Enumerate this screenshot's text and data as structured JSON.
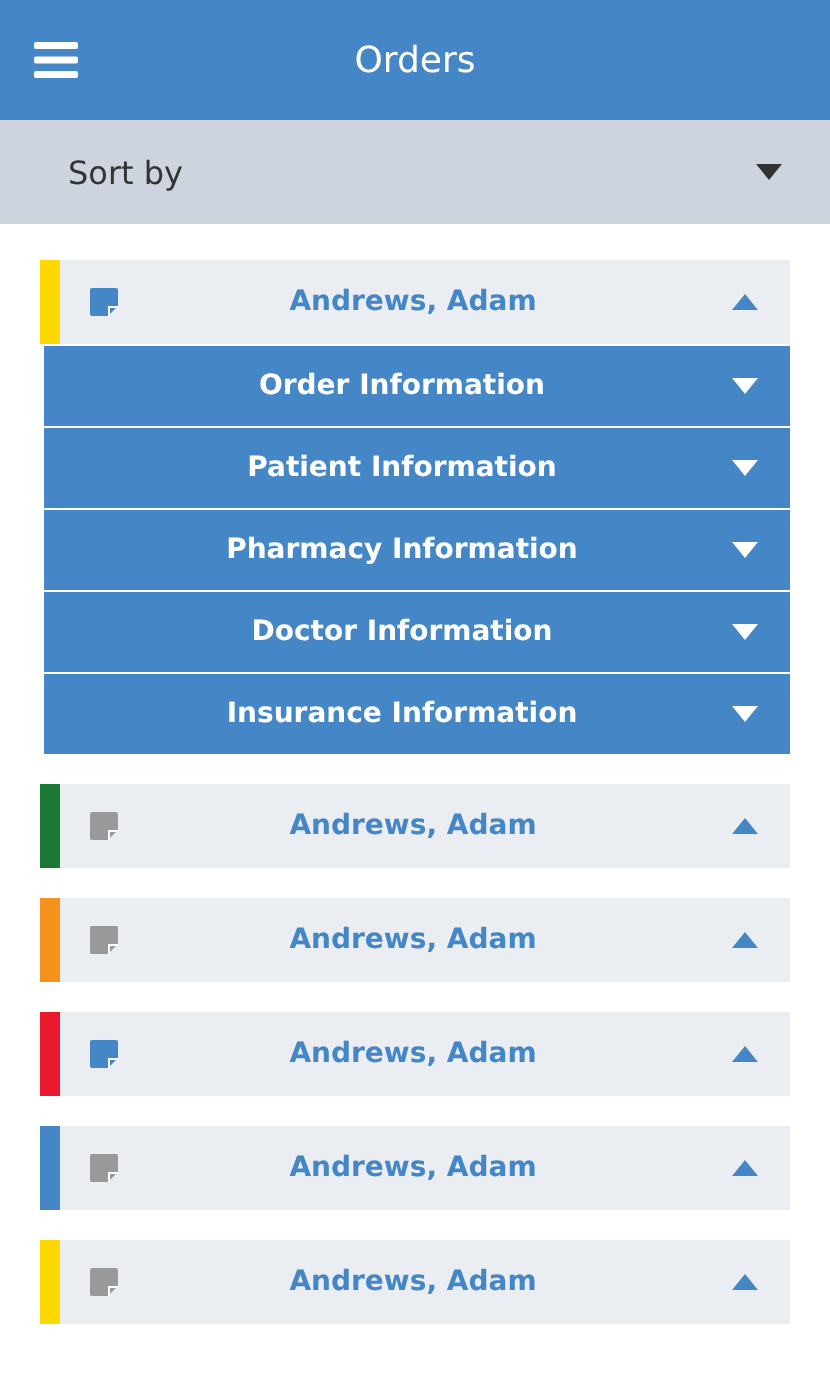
{
  "header": {
    "title": "Orders"
  },
  "sort": {
    "label": "Sort by"
  },
  "orders": [
    {
      "name": "Andrews, Adam",
      "color": "#ffd800",
      "has_note": true,
      "sections": [
        {
          "label": "Order Information",
          "expanded": false
        },
        {
          "label": "Patient Information",
          "expanded": false
        },
        {
          "label": "Pharmacy Information",
          "expanded": false
        },
        {
          "label": "Doctor Information",
          "expanded": false
        },
        {
          "label": "Insurance Information",
          "expanded": false
        }
      ]
    },
    {
      "name": "Andrews, Adam",
      "color": "#1a7a35",
      "has_note": false
    },
    {
      "name": "Andrews, Adam",
      "color": "#f5921e",
      "has_note": false
    },
    {
      "name": "Andrews, Adam",
      "color": "#e8192c",
      "has_note": true
    },
    {
      "name": "Andrews, Adam",
      "color": "#4486c6",
      "has_note": false
    },
    {
      "name": "Andrews, Adam",
      "color": "#ffd800",
      "has_note": false
    }
  ]
}
